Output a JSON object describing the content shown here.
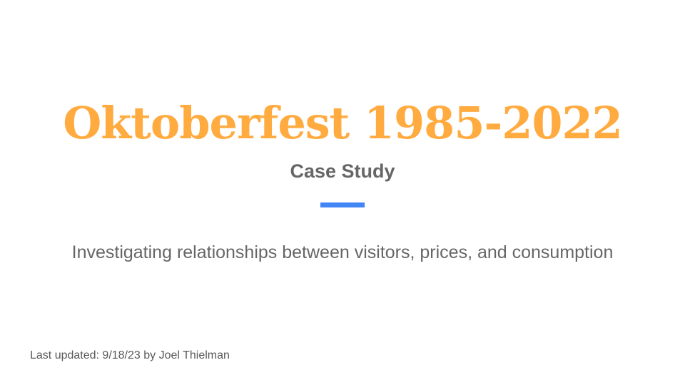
{
  "slide": {
    "title": "Oktoberfest 1985-2022",
    "subtitle": "Case Study",
    "tagline": "Investigating relationships between visitors, prices, and consumption",
    "footer": "Last updated: 9/18/23 by Joel Thielman"
  },
  "colors": {
    "background": "#ffffff",
    "title": "#ffab40",
    "subtitle": "#666666",
    "accent": "#4285f4",
    "body_text": "#666666",
    "footer_text": "#595959"
  }
}
